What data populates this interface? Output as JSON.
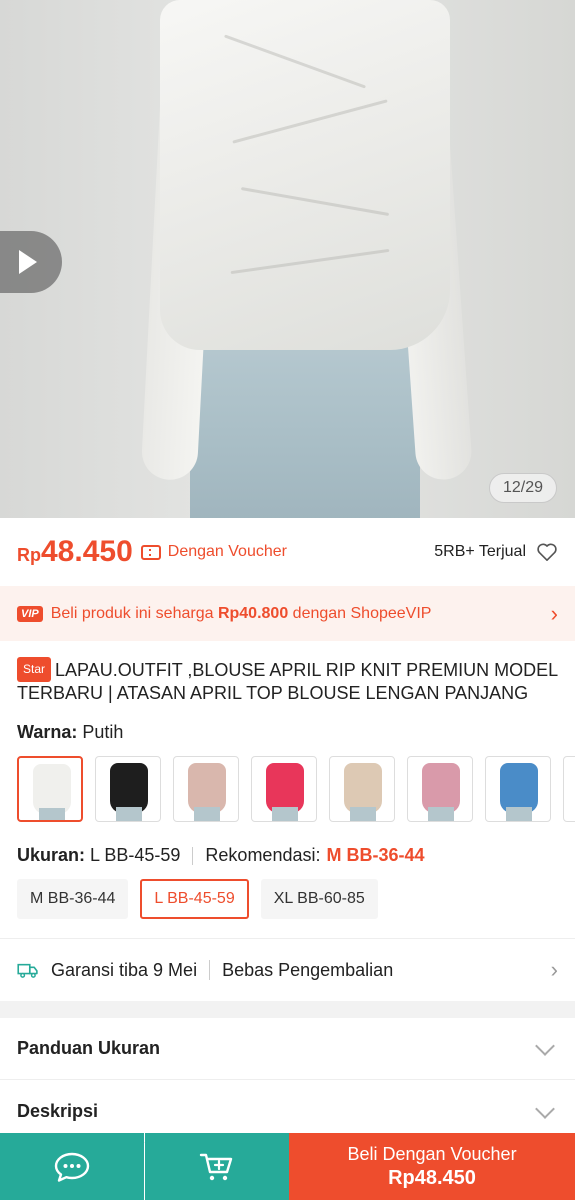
{
  "hero": {
    "image_counter": "12/29",
    "video_icon": "play-icon"
  },
  "price": {
    "currency": "Rp",
    "amount": "48.450",
    "voucher_label": "Dengan Voucher",
    "sold": "5RB+ Terjual"
  },
  "vip": {
    "badge": "VIP",
    "text_before": "Beli produk ini seharga ",
    "vip_price": "Rp40.800",
    "text_after": " dengan ShopeeVIP"
  },
  "product": {
    "badge": "Star",
    "title": "LAPAU.OUTFIT ,BLOUSE APRIL RIP KNIT  PREMIUN MODEL TERBARU | ATASAN APRIL TOP BLOUSE LENGAN PANJANG"
  },
  "variant": {
    "color_label": "Warna:",
    "color_value": "Putih",
    "swatches": [
      "#f0f0ed",
      "#1e1e1e",
      "#d9b7ad",
      "#e8365a",
      "#ddc9b4",
      "#d99aaa",
      "#4a8cc8"
    ]
  },
  "size": {
    "label": "Ukuran:",
    "value": "L BB-45-59",
    "rec_label": "Rekomendasi:",
    "rec_value": "M BB-36-44",
    "options": [
      "M BB-36-44",
      "L BB-45-59",
      "XL BB-60-85"
    ]
  },
  "shipping": {
    "guarantee": "Garansi tiba 9 Mei",
    "returns": "Bebas Pengembalian"
  },
  "sections": {
    "size_guide": "Panduan Ukuran",
    "description": "Deskripsi"
  },
  "bottom_bar": {
    "buy_label": "Beli Dengan Voucher",
    "buy_price": "Rp48.450"
  },
  "colors": {
    "accent": "#ee4d2d",
    "teal": "#26aa99"
  }
}
